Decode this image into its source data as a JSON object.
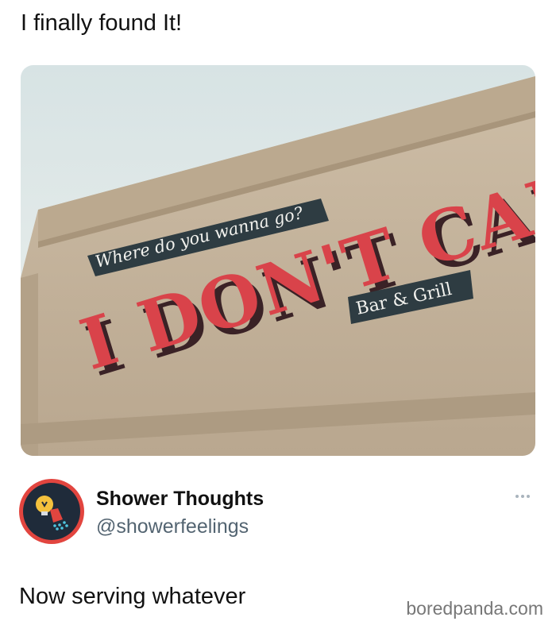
{
  "post": {
    "caption": "I finally found It!"
  },
  "photo": {
    "sign_top": "Where do you wanna go?",
    "sign_main": "I DON'T CARE",
    "sign_bottom": "Bar & Grill",
    "colors": {
      "sky": "#dfe7e8",
      "wall": "#c9b8a0",
      "letters": "#d9434a",
      "plaque": "#2e3c42"
    }
  },
  "author": {
    "display_name": "Shower Thoughts",
    "handle": "@showerfeelings",
    "avatar_icon": "lightbulb-shower-icon",
    "avatar_ring_color": "#e2453f"
  },
  "reply": {
    "text": "Now serving whatever"
  },
  "watermark": "boredpanda.com"
}
